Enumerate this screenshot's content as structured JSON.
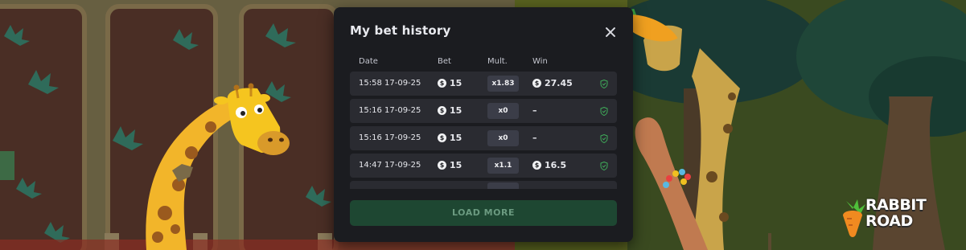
{
  "modal": {
    "title": "My bet history",
    "columns": {
      "date": "Date",
      "bet": "Bet",
      "mult": "Mult.",
      "win": "Win"
    },
    "rows": [
      {
        "date": "15:58 17-09-25",
        "bet": "15",
        "mult": "x1.83",
        "win": "27.45",
        "win_has_coin": true
      },
      {
        "date": "15:16 17-09-25",
        "bet": "15",
        "mult": "x0",
        "win": "–",
        "win_has_coin": false
      },
      {
        "date": "15:16 17-09-25",
        "bet": "15",
        "mult": "x0",
        "win": "–",
        "win_has_coin": false
      },
      {
        "date": "14:47 17-09-25",
        "bet": "15",
        "mult": "x1.1",
        "win": "16.5",
        "win_has_coin": true
      }
    ],
    "load_more_label": "LOAD MORE",
    "coin_symbol": "$"
  },
  "logo": {
    "line1": "RABBIT",
    "line2": "ROAD"
  },
  "colors": {
    "modal_bg": "#1b1c20",
    "row_bg": "#2a2b31",
    "mult_bg": "#3b3d48",
    "load_more_bg": "#1e4732",
    "shield": "#3fae5a"
  }
}
